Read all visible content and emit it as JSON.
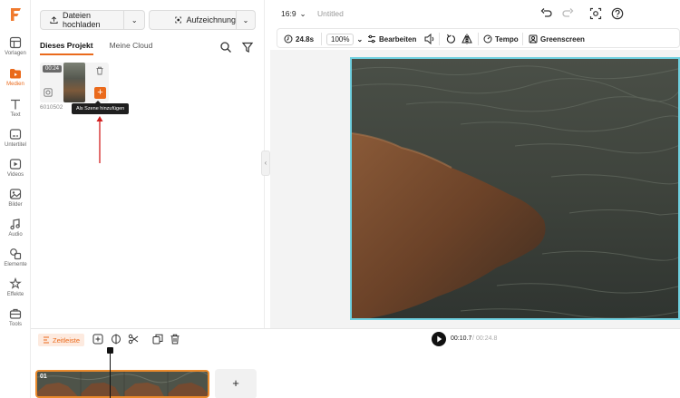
{
  "app": {
    "accent": "#ea6a1c",
    "logo_icon": "filmora-f-logo"
  },
  "rail": {
    "items": [
      {
        "label": "Vorlagen",
        "icon": "template-icon"
      },
      {
        "label": "Medien",
        "icon": "media-icon"
      },
      {
        "label": "Text",
        "icon": "text-icon"
      },
      {
        "label": "Untertitel",
        "icon": "subtitle-icon"
      },
      {
        "label": "Videos",
        "icon": "video-icon"
      },
      {
        "label": "Bilder",
        "icon": "image-icon"
      },
      {
        "label": "Audio",
        "icon": "audio-icon"
      },
      {
        "label": "Elemente",
        "icon": "elements-icon"
      },
      {
        "label": "Effekte",
        "icon": "effects-icon"
      },
      {
        "label": "Tools",
        "icon": "tools-icon"
      }
    ]
  },
  "panel": {
    "upload_label": "Dateien hochladen",
    "record_label": "Aufzeichnung",
    "tabs": [
      {
        "label": "Dieses Projekt"
      },
      {
        "label": "Meine Cloud"
      }
    ],
    "media": {
      "duration": "00:24",
      "name": "6010502"
    },
    "tooltip": "Als Szene hinzufügen"
  },
  "topbar": {
    "ratio": "16:9",
    "title": "Untitled"
  },
  "toolbar": {
    "speed": "24.8s",
    "zoom": "100%",
    "edit_label": "Bearbeiten",
    "tempo_label": "Tempo",
    "greenscreen_label": "Greenscreen"
  },
  "timeline": {
    "label": "Zeitleiste",
    "current_time": "00:10.7",
    "separator": "/",
    "total_time": "00:24.8",
    "clip_label": "01",
    "add_label": "+"
  }
}
